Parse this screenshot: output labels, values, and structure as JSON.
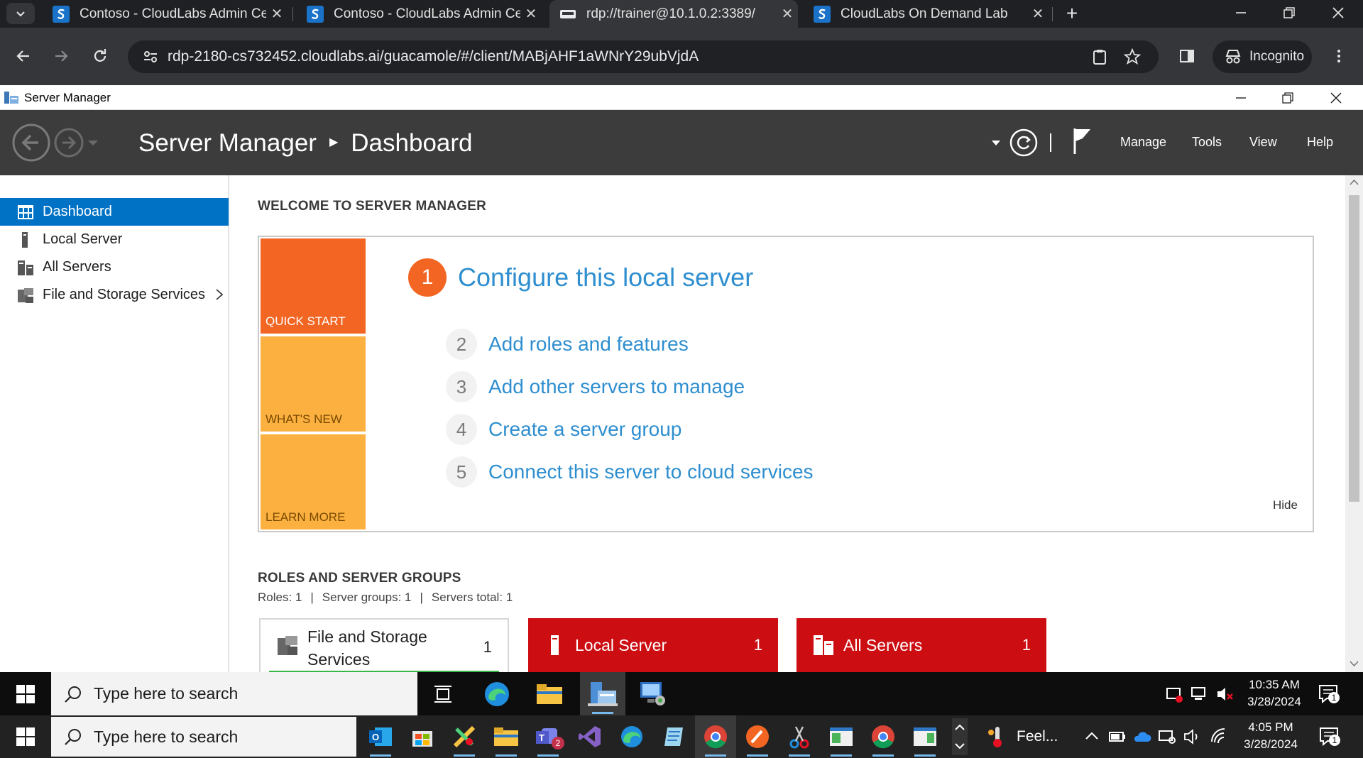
{
  "browser": {
    "tabs": [
      {
        "title": "Contoso - CloudLabs Admin Ce",
        "active": false
      },
      {
        "title": "Contoso - CloudLabs Admin Ce",
        "active": false
      },
      {
        "title": "rdp://trainer@10.1.0.2:3389/",
        "active": true
      },
      {
        "title": "CloudLabs On Demand Lab",
        "active": false
      }
    ],
    "url": "rdp-2180-cs732452.cloudlabs.ai/guacamole/#/client/MABjAHF1aWNrY29ubVjdA",
    "incognito_label": "Incognito"
  },
  "server_manager": {
    "window_title": "Server Manager",
    "breadcrumb_app": "Server Manager",
    "breadcrumb_page": "Dashboard",
    "menu": [
      "Manage",
      "Tools",
      "View",
      "Help"
    ],
    "sidebar": [
      {
        "label": "Dashboard",
        "active": true
      },
      {
        "label": "Local Server",
        "active": false
      },
      {
        "label": "All Servers",
        "active": false
      },
      {
        "label": "File and Storage Services",
        "active": false
      }
    ],
    "welcome_title": "WELCOME TO SERVER MANAGER",
    "tiles": [
      "QUICK START",
      "WHAT'S NEW",
      "LEARN MORE"
    ],
    "main_step": {
      "number": "1",
      "label": "Configure this local server"
    },
    "steps": [
      {
        "number": "2",
        "label": "Add roles and features"
      },
      {
        "number": "3",
        "label": "Add other servers to manage"
      },
      {
        "number": "4",
        "label": "Create a server group"
      },
      {
        "number": "5",
        "label": "Connect this server to cloud services"
      }
    ],
    "hide_label": "Hide",
    "roles_title": "ROLES AND SERVER GROUPS",
    "roles_summary": {
      "roles": "Roles: 1",
      "groups": "Server groups: 1",
      "total": "Servers total: 1",
      "separator": "|"
    },
    "role_cards": [
      {
        "name_line1": "File and Storage",
        "name_line2": "Services",
        "count": "1"
      },
      {
        "name": "Local Server",
        "count": "1"
      },
      {
        "name": "All Servers",
        "count": "1"
      }
    ]
  },
  "remote_taskbar": {
    "search_placeholder": "Type here to search",
    "time": "10:35 AM",
    "date": "3/28/2024",
    "notification_count": "1"
  },
  "host_taskbar": {
    "search_placeholder": "Type here to search",
    "weather_label": "Feel...",
    "time": "4:05 PM",
    "date": "3/28/2024",
    "notification_count": "1",
    "teams_badge": "2"
  },
  "colors": {
    "accent_blue": "#0072c6",
    "link_blue": "#2e8ecf",
    "quick_start_orange": "#f26522",
    "tile_yellow": "#fbb040",
    "alert_red": "#cc0d12",
    "ok_green": "#39b54a"
  }
}
